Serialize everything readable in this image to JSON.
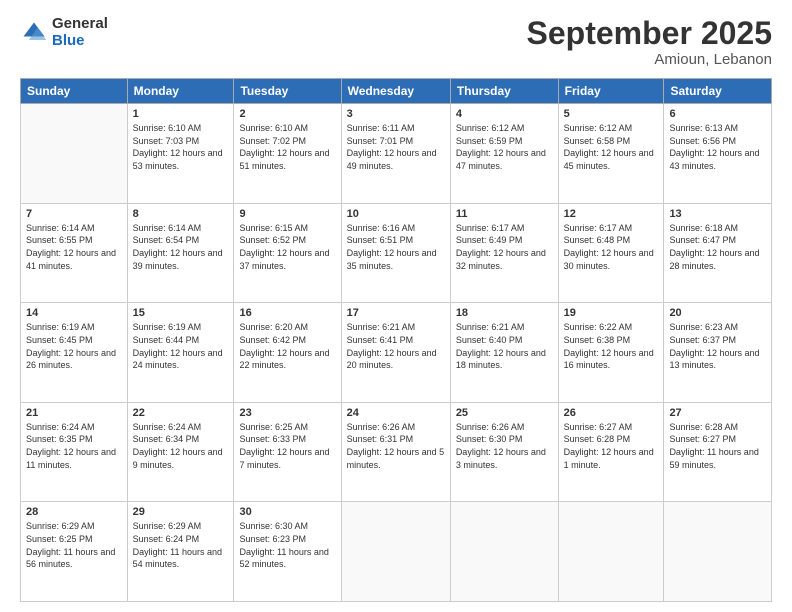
{
  "logo": {
    "general": "General",
    "blue": "Blue"
  },
  "header": {
    "title": "September 2025",
    "subtitle": "Amioun, Lebanon"
  },
  "calendar": {
    "days_of_week": [
      "Sunday",
      "Monday",
      "Tuesday",
      "Wednesday",
      "Thursday",
      "Friday",
      "Saturday"
    ],
    "weeks": [
      [
        {
          "day": "",
          "sunrise": "",
          "sunset": "",
          "daylight": ""
        },
        {
          "day": "1",
          "sunrise": "Sunrise: 6:10 AM",
          "sunset": "Sunset: 7:03 PM",
          "daylight": "Daylight: 12 hours and 53 minutes."
        },
        {
          "day": "2",
          "sunrise": "Sunrise: 6:10 AM",
          "sunset": "Sunset: 7:02 PM",
          "daylight": "Daylight: 12 hours and 51 minutes."
        },
        {
          "day": "3",
          "sunrise": "Sunrise: 6:11 AM",
          "sunset": "Sunset: 7:01 PM",
          "daylight": "Daylight: 12 hours and 49 minutes."
        },
        {
          "day": "4",
          "sunrise": "Sunrise: 6:12 AM",
          "sunset": "Sunset: 6:59 PM",
          "daylight": "Daylight: 12 hours and 47 minutes."
        },
        {
          "day": "5",
          "sunrise": "Sunrise: 6:12 AM",
          "sunset": "Sunset: 6:58 PM",
          "daylight": "Daylight: 12 hours and 45 minutes."
        },
        {
          "day": "6",
          "sunrise": "Sunrise: 6:13 AM",
          "sunset": "Sunset: 6:56 PM",
          "daylight": "Daylight: 12 hours and 43 minutes."
        }
      ],
      [
        {
          "day": "7",
          "sunrise": "Sunrise: 6:14 AM",
          "sunset": "Sunset: 6:55 PM",
          "daylight": "Daylight: 12 hours and 41 minutes."
        },
        {
          "day": "8",
          "sunrise": "Sunrise: 6:14 AM",
          "sunset": "Sunset: 6:54 PM",
          "daylight": "Daylight: 12 hours and 39 minutes."
        },
        {
          "day": "9",
          "sunrise": "Sunrise: 6:15 AM",
          "sunset": "Sunset: 6:52 PM",
          "daylight": "Daylight: 12 hours and 37 minutes."
        },
        {
          "day": "10",
          "sunrise": "Sunrise: 6:16 AM",
          "sunset": "Sunset: 6:51 PM",
          "daylight": "Daylight: 12 hours and 35 minutes."
        },
        {
          "day": "11",
          "sunrise": "Sunrise: 6:17 AM",
          "sunset": "Sunset: 6:49 PM",
          "daylight": "Daylight: 12 hours and 32 minutes."
        },
        {
          "day": "12",
          "sunrise": "Sunrise: 6:17 AM",
          "sunset": "Sunset: 6:48 PM",
          "daylight": "Daylight: 12 hours and 30 minutes."
        },
        {
          "day": "13",
          "sunrise": "Sunrise: 6:18 AM",
          "sunset": "Sunset: 6:47 PM",
          "daylight": "Daylight: 12 hours and 28 minutes."
        }
      ],
      [
        {
          "day": "14",
          "sunrise": "Sunrise: 6:19 AM",
          "sunset": "Sunset: 6:45 PM",
          "daylight": "Daylight: 12 hours and 26 minutes."
        },
        {
          "day": "15",
          "sunrise": "Sunrise: 6:19 AM",
          "sunset": "Sunset: 6:44 PM",
          "daylight": "Daylight: 12 hours and 24 minutes."
        },
        {
          "day": "16",
          "sunrise": "Sunrise: 6:20 AM",
          "sunset": "Sunset: 6:42 PM",
          "daylight": "Daylight: 12 hours and 22 minutes."
        },
        {
          "day": "17",
          "sunrise": "Sunrise: 6:21 AM",
          "sunset": "Sunset: 6:41 PM",
          "daylight": "Daylight: 12 hours and 20 minutes."
        },
        {
          "day": "18",
          "sunrise": "Sunrise: 6:21 AM",
          "sunset": "Sunset: 6:40 PM",
          "daylight": "Daylight: 12 hours and 18 minutes."
        },
        {
          "day": "19",
          "sunrise": "Sunrise: 6:22 AM",
          "sunset": "Sunset: 6:38 PM",
          "daylight": "Daylight: 12 hours and 16 minutes."
        },
        {
          "day": "20",
          "sunrise": "Sunrise: 6:23 AM",
          "sunset": "Sunset: 6:37 PM",
          "daylight": "Daylight: 12 hours and 13 minutes."
        }
      ],
      [
        {
          "day": "21",
          "sunrise": "Sunrise: 6:24 AM",
          "sunset": "Sunset: 6:35 PM",
          "daylight": "Daylight: 12 hours and 11 minutes."
        },
        {
          "day": "22",
          "sunrise": "Sunrise: 6:24 AM",
          "sunset": "Sunset: 6:34 PM",
          "daylight": "Daylight: 12 hours and 9 minutes."
        },
        {
          "day": "23",
          "sunrise": "Sunrise: 6:25 AM",
          "sunset": "Sunset: 6:33 PM",
          "daylight": "Daylight: 12 hours and 7 minutes."
        },
        {
          "day": "24",
          "sunrise": "Sunrise: 6:26 AM",
          "sunset": "Sunset: 6:31 PM",
          "daylight": "Daylight: 12 hours and 5 minutes."
        },
        {
          "day": "25",
          "sunrise": "Sunrise: 6:26 AM",
          "sunset": "Sunset: 6:30 PM",
          "daylight": "Daylight: 12 hours and 3 minutes."
        },
        {
          "day": "26",
          "sunrise": "Sunrise: 6:27 AM",
          "sunset": "Sunset: 6:28 PM",
          "daylight": "Daylight: 12 hours and 1 minute."
        },
        {
          "day": "27",
          "sunrise": "Sunrise: 6:28 AM",
          "sunset": "Sunset: 6:27 PM",
          "daylight": "Daylight: 11 hours and 59 minutes."
        }
      ],
      [
        {
          "day": "28",
          "sunrise": "Sunrise: 6:29 AM",
          "sunset": "Sunset: 6:25 PM",
          "daylight": "Daylight: 11 hours and 56 minutes."
        },
        {
          "day": "29",
          "sunrise": "Sunrise: 6:29 AM",
          "sunset": "Sunset: 6:24 PM",
          "daylight": "Daylight: 11 hours and 54 minutes."
        },
        {
          "day": "30",
          "sunrise": "Sunrise: 6:30 AM",
          "sunset": "Sunset: 6:23 PM",
          "daylight": "Daylight: 11 hours and 52 minutes."
        },
        {
          "day": "",
          "sunrise": "",
          "sunset": "",
          "daylight": ""
        },
        {
          "day": "",
          "sunrise": "",
          "sunset": "",
          "daylight": ""
        },
        {
          "day": "",
          "sunrise": "",
          "sunset": "",
          "daylight": ""
        },
        {
          "day": "",
          "sunrise": "",
          "sunset": "",
          "daylight": ""
        }
      ]
    ]
  }
}
